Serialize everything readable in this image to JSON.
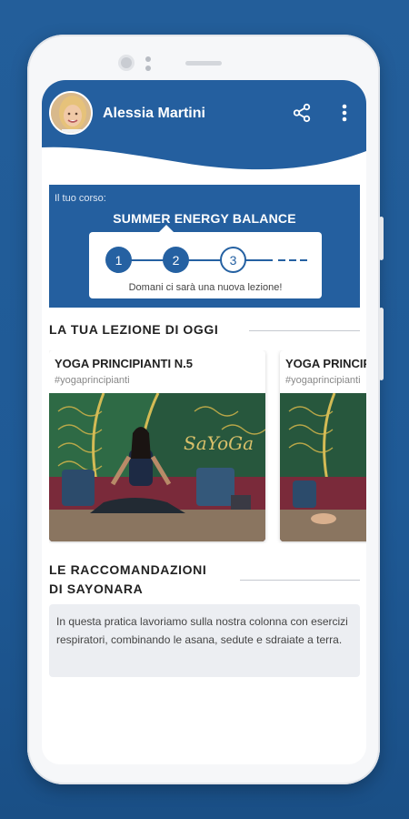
{
  "profile": {
    "name": "Alessia Martini"
  },
  "course": {
    "label": "Il tuo corso:",
    "title": "SUMMER ENERGY BALANCE",
    "steps": [
      "1",
      "2",
      "3"
    ],
    "current_step": 2,
    "note": "Domani ci sarà una nuova lezione!"
  },
  "today": {
    "section_title": "LA TUA LEZIONE DI OGGI",
    "cards": [
      {
        "title": "YOGA PRINCIPIANTI N.5",
        "tag": "#yogaprincipianti",
        "brand": "SaYoGa"
      },
      {
        "title": "YOGA PRINCIPIANTI",
        "tag": "#yogaprincipianti"
      }
    ]
  },
  "recommendations": {
    "section_title_line1": "LE RACCOMANDAZIONI",
    "section_title_line2": "DI SAYONARA",
    "text": "In questa pratica lavoriamo sulla nostra colonna con esercizi respiratori, combinando le asana, sedute e sdraiate a terra."
  },
  "icons": {
    "share": "share-icon",
    "menu": "more-vertical-icon"
  },
  "colors": {
    "brand_blue": "#245f9f",
    "background_blue": "#1f5a96"
  }
}
